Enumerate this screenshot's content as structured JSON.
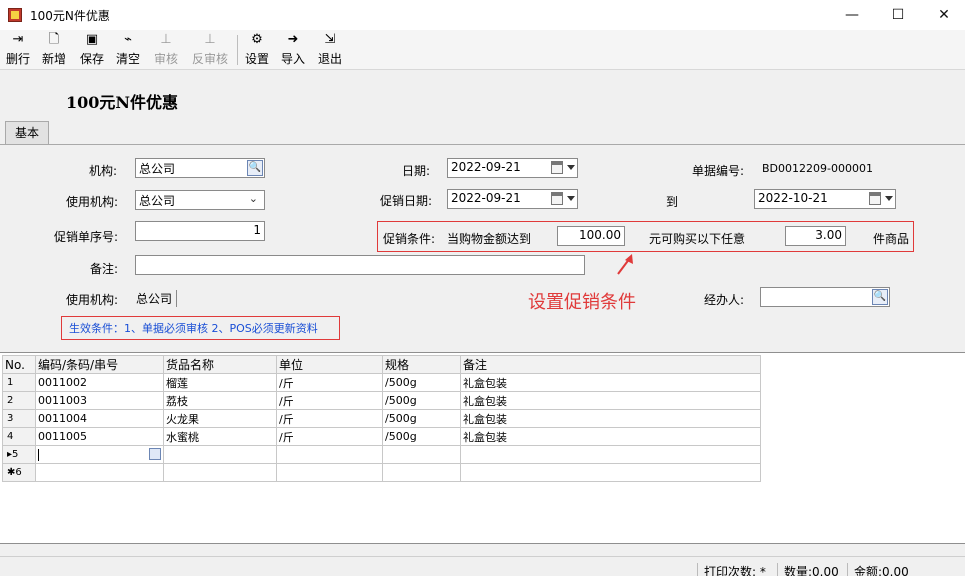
{
  "window": {
    "title": "100元N件优惠",
    "minimize": "—",
    "maximize": "☐",
    "close": "✕"
  },
  "toolbar": {
    "delete_row": "删行",
    "new": "新增",
    "save": "保存",
    "clear": "清空",
    "audit": "审核",
    "unaudit": "反审核",
    "settings": "设置",
    "import": "导入",
    "exit": "退出"
  },
  "form": {
    "title": "100元N件优惠",
    "tab_basic": "基本",
    "org_label": "机构:",
    "org_value": "总公司",
    "date_label": "日期:",
    "date_value": "2022-09-21",
    "doc_no_label": "单据编号:",
    "doc_no_value": "BD0012209-000001",
    "use_org_label": "使用机构:",
    "use_org_value": "总公司",
    "promo_date_label": "促销日期:",
    "promo_date_from": "2022-09-21",
    "to_label": "到",
    "promo_date_to": "2022-10-21",
    "promo_seq_label": "促销单序号:",
    "promo_seq_value": "1",
    "promo_cond_label": "促销条件:",
    "cond_text1": "当购物金额达到",
    "cond_amount": "100.00",
    "cond_text2": "元可购买以下任意",
    "cond_qty": "3.00",
    "cond_text3": "件商品",
    "remark_label": "备注:",
    "remark_value": "",
    "use_org2_label": "使用机构:",
    "use_org2_value": "总公司",
    "handler_label": "经办人:",
    "handler_value": "",
    "annotation": "设置促销条件",
    "effective_note": "生效条件：1、单据必须审核 2、POS必须更新资料"
  },
  "grid": {
    "headers": [
      "No.",
      "编码/条码/串号",
      "货品名称",
      "单位",
      "规格",
      "备注"
    ],
    "rows": [
      [
        "1",
        "0011002",
        "榴莲",
        "/斤",
        "/500g",
        "礼盒包装"
      ],
      [
        "2",
        "0011003",
        "荔枝",
        "/斤",
        "/500g",
        "礼盒包装"
      ],
      [
        "3",
        "0011004",
        "火龙果",
        "/斤",
        "/500g",
        "礼盒包装"
      ],
      [
        "4",
        "0011005",
        "水蜜桃",
        "/斤",
        "/500g",
        "礼盒包装"
      ]
    ],
    "current_row_no": "▸5",
    "new_row_no": "✱6"
  },
  "status": {
    "print_count": "打印次数: *",
    "quantity": "数量:0.00",
    "amount": "金额:0.00"
  },
  "colors": {
    "annotation_red": "#e03a3a",
    "effective_blue": "#1a4fd6"
  }
}
